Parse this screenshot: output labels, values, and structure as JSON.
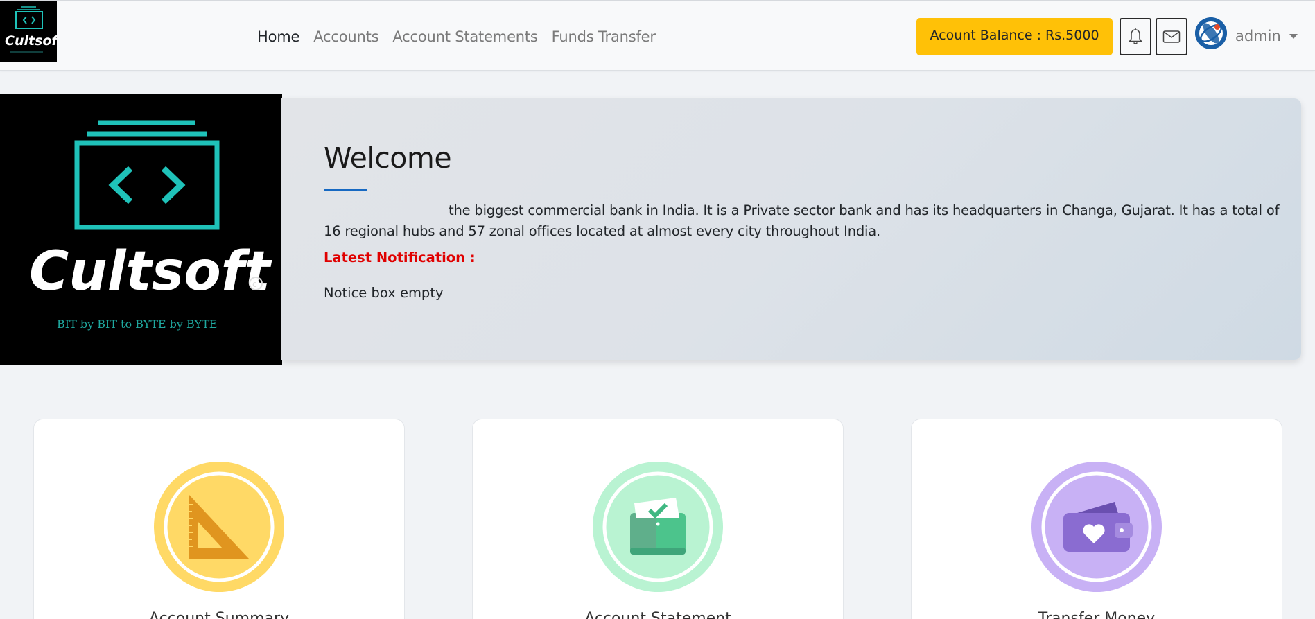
{
  "brand": {
    "logo_text": "Cultsoft",
    "tagline": "BIT by BIT to BYTE by BYTE",
    "copyright_mark": "©"
  },
  "nav": {
    "links": [
      {
        "label": "Home",
        "active": true
      },
      {
        "label": "Accounts",
        "active": false
      },
      {
        "label": "Account Statements",
        "active": false
      },
      {
        "label": "Funds Transfer",
        "active": false
      }
    ],
    "balance_label": "Acount Balance : Rs.5000",
    "bell_icon": "bell-icon",
    "mail_icon": "envelope-icon",
    "user_name": "admin"
  },
  "hero": {
    "title": "Welcome",
    "description": "the biggest commercial bank in India. It is a Private sector bank and has its headquarters in Changa, Gujarat. It has a total of 16 regional hubs and 57 zonal offices located at almost every city throughout India.",
    "notification_label": "Latest Notification :",
    "notice_text": "Notice box empty"
  },
  "cards": [
    {
      "title": "Account Summary",
      "icon": "set-square-icon",
      "color": "#ffd966"
    },
    {
      "title": "Account Statement",
      "icon": "wallet-check-icon",
      "color": "#b9f3d2"
    },
    {
      "title": "Transfer Money",
      "icon": "wallet-heart-icon",
      "color": "#c8b1f5"
    }
  ],
  "colors": {
    "balance_bg": "#ffc107",
    "notification_red": "#e00000",
    "accent_blue": "#1769c2",
    "logo_teal": "#1fc2b9"
  }
}
